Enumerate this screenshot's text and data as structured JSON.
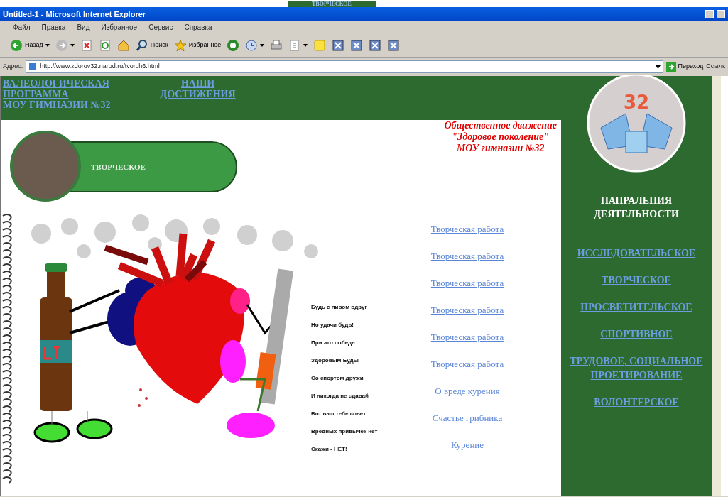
{
  "background_window": {
    "text": "ТВОРЧЕСКОЕ"
  },
  "browser": {
    "title": "Untitled-1 - Microsoft Internet Explorer",
    "menu": [
      "Файл",
      "Правка",
      "Вид",
      "Избранное",
      "Сервис",
      "Справка"
    ],
    "toolbar": [
      {
        "kind": "back",
        "label": "Назад",
        "has_menu": true
      },
      {
        "kind": "forward",
        "has_menu": true
      },
      {
        "kind": "stop"
      },
      {
        "kind": "refresh"
      },
      {
        "kind": "home"
      },
      {
        "kind": "search",
        "label": "Поиск"
      },
      {
        "kind": "favorites",
        "label": "Избранное"
      },
      {
        "kind": "media"
      },
      {
        "kind": "history",
        "has_menu": true
      },
      {
        "kind": "print"
      },
      {
        "kind": "edit",
        "has_menu": true
      },
      {
        "kind": "note"
      },
      {
        "kind": "app"
      },
      {
        "kind": "app"
      },
      {
        "kind": "app"
      },
      {
        "kind": "app"
      }
    ],
    "address_label": "Адрес:",
    "url": "http://www.zdorov32.narod.ru/tvorch6.html",
    "go_label": "Переход",
    "links_label": "Ссылк"
  },
  "page": {
    "top_links": [
      {
        "lines": [
          "ВАЛЕОЛОГИЧЕСКАЯ",
          "ПРОГРАММА",
          "МОУ ГИМНАЗИИ №32"
        ]
      },
      {
        "lines": [
          "НАШИ",
          "ДОСТИЖЕНИЯ"
        ]
      }
    ],
    "banner": "ТВОРЧЕСКОЕ",
    "org_heading": [
      "Общественное движение",
      "\"Здоровое поколение\"",
      "МОУ гимназии №32"
    ],
    "poem": [
      "Будь с пивом вдруг",
      "Но удачи будь!",
      "При это победа.",
      "Здоровым Будь!",
      "Со спортом дружи",
      "И никогда не сдавай",
      "Вот ваш тебе совет",
      "Вредных привычек нет",
      "Скажи - НЕТ!"
    ],
    "works": [
      "Творческая работа",
      "Творческая работа",
      "Творческая работа",
      "Творческая работа",
      "Творческая работа",
      "Творческая работа",
      "О вреде курения",
      "Счастье грибника",
      "Курение"
    ],
    "sidebar": {
      "logo_number": "32",
      "heading": "НАПРАЛЕНИЯ ДЕЯТЕЛЬНОСТИ",
      "links": [
        "ИССЛЕДОВАТЕЛЬСКОЕ",
        "ТВОРЧЕСКОЕ",
        "ПРОСВЕТИТЕЛЬСКОЕ",
        "СПОРТИВНОЕ",
        "ТРУДОВОЕ, СОЦИАЛЬНОЕ ПРОЕТИРОВАНИЕ",
        "ВОЛОНТЕРСКОЕ"
      ]
    }
  }
}
